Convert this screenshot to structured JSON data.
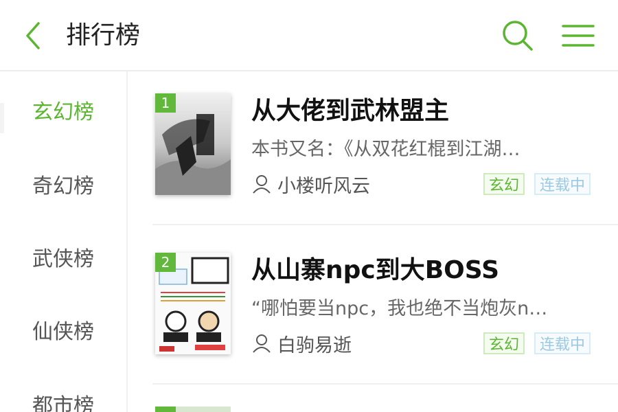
{
  "header": {
    "title": "排行榜",
    "icons": {
      "back": "chevron-left-icon",
      "search": "search-icon",
      "menu": "menu-icon"
    },
    "accent_color": "#5cb531"
  },
  "sidebar": {
    "items": [
      {
        "label": "玄幻榜",
        "active": true
      },
      {
        "label": "奇幻榜",
        "active": false
      },
      {
        "label": "武侠榜",
        "active": false
      },
      {
        "label": "仙侠榜",
        "active": false
      },
      {
        "label": "都市榜",
        "active": false
      }
    ]
  },
  "books": [
    {
      "rank": "1",
      "title": "从大佬到武林盟主",
      "description": "本书又名：《从双花红棍到江湖…",
      "author": "小楼听风云",
      "genre": "玄幻",
      "status": "连载中"
    },
    {
      "rank": "2",
      "title": "从山寨npc到大BOSS",
      "description": "“哪怕要当npc，我也绝不当炮灰n…",
      "author": "白驹易逝",
      "genre": "玄幻",
      "status": "连载中"
    }
  ]
}
